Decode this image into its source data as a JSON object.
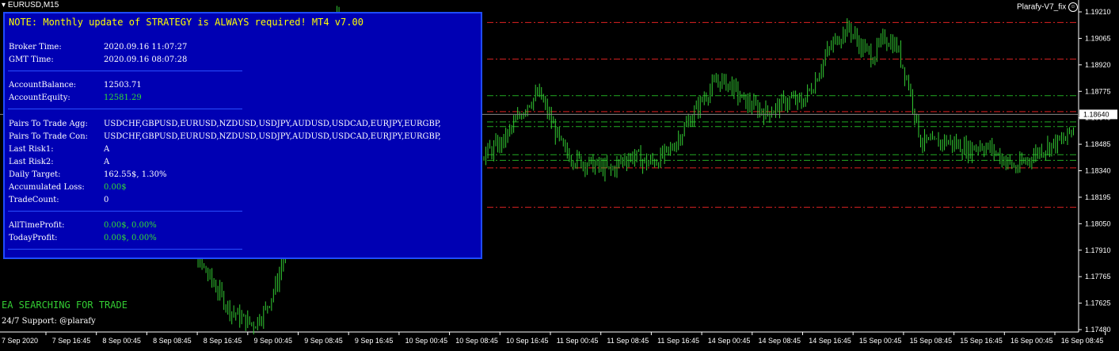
{
  "window": {
    "symbol_title": "EURUSD,M15",
    "ea_name": "Plarafy-V7_fix"
  },
  "panel": {
    "note": "NOTE: Monthly update of STRATEGY is ALWAYS required! MT4 v7.00",
    "rows": [
      {
        "label": "Broker Time:",
        "value": "2020.09.16 11:07:27"
      },
      {
        "label": "GMT Time:",
        "value": "2020.09.16 08:07:28"
      },
      {
        "label": "AccountBalance:",
        "value": "12503.71"
      },
      {
        "label": "AccountEquity:",
        "value": "12581.29"
      },
      {
        "label": "Pairs To Trade Agg:",
        "value": "USDCHF,GBPUSD,EURUSD,NZDUSD,USDJPY,AUDUSD,USDCAD,EURJPY,EURGBP,"
      },
      {
        "label": "Pairs To Trade Con:",
        "value": "USDCHF,GBPUSD,EURUSD,NZDUSD,USDJPY,AUDUSD,USDCAD,EURJPY,EURGBP,"
      },
      {
        "label": "Last Risk1:",
        "value": "A"
      },
      {
        "label": "Last Risk2:",
        "value": "A"
      },
      {
        "label": "Daily Target:",
        "value": "162.55$, 1.30%"
      },
      {
        "label": "Accumulated Loss:",
        "value": "0.00$"
      },
      {
        "label": "TradeCount:",
        "value": "0"
      },
      {
        "label": "AllTimeProfit:",
        "value": "0.00$, 0.00%"
      },
      {
        "label": "TodayProfit:",
        "value": "0.00$, 0.00%"
      }
    ]
  },
  "status_text": "EA SEARCHING FOR TRADE",
  "support_text": "24/7 Support: @plarafy",
  "price_axis": {
    "labels": [
      "1.19210",
      "1.19065",
      "1.18920",
      "1.18775",
      "1.18640",
      "1.18485",
      "1.18340",
      "1.18195",
      "1.18050",
      "1.17910",
      "1.17765",
      "1.17625",
      "1.17480"
    ],
    "current_price": "1.18640"
  },
  "time_axis": {
    "labels": [
      "7 Sep 2020",
      "7 Sep 16:45",
      "8 Sep 00:45",
      "8 Sep 08:45",
      "8 Sep 16:45",
      "9 Sep 00:45",
      "9 Sep 08:45",
      "9 Sep 16:45",
      "10 Sep 00:45",
      "10 Sep 08:45",
      "10 Sep 16:45",
      "11 Sep 00:45",
      "11 Sep 08:45",
      "11 Sep 16:45",
      "14 Sep 00:45",
      "14 Sep 08:45",
      "14 Sep 16:45",
      "15 Sep 00:45",
      "15 Sep 08:45",
      "15 Sep 16:45",
      "16 Sep 00:45",
      "16 Sep 08:45"
    ]
  },
  "colors": {
    "bars": "#33cc33",
    "red_level": "#dd2222",
    "green_level": "#22aa22",
    "panel_bg": "#0000b3",
    "note": "#ffff00"
  },
  "chart_data": {
    "type": "line",
    "title": "EURUSD,M15",
    "y_range": [
      1.1748,
      1.1925
    ],
    "red_levels": [
      1.1913,
      1.18935,
      1.18655,
      1.18355,
      1.18145
    ],
    "green_levels": [
      1.1874,
      1.186,
      1.18575,
      1.18425,
      1.18395
    ],
    "close_series": [
      1.182,
      1.18,
      1.179,
      1.178,
      1.177,
      1.176,
      1.1755,
      1.1752,
      1.176,
      1.1775,
      1.18,
      1.183,
      1.186,
      1.189,
      1.1915,
      1.1905,
      1.188,
      1.185,
      1.183,
      1.181,
      1.1815,
      1.182,
      1.183,
      1.1835,
      1.1838,
      1.184,
      1.1842,
      1.1845,
      1.185,
      1.186,
      1.187,
      1.1875,
      1.186,
      1.1845,
      1.184,
      1.1838,
      1.1836,
      1.1834,
      1.184,
      1.1842,
      1.1838,
      1.184,
      1.1845,
      1.1855,
      1.1865,
      1.1875,
      1.1882,
      1.188,
      1.1872,
      1.1868,
      1.1865,
      1.1868,
      1.1872,
      1.187,
      1.188,
      1.1895,
      1.1905,
      1.191,
      1.19,
      1.1895,
      1.1905,
      1.19,
      1.188,
      1.185,
      1.1848,
      1.185,
      1.1848,
      1.1845,
      1.1848,
      1.1845,
      1.184,
      1.1835,
      1.184,
      1.1845,
      1.1848,
      1.185,
      1.1858
    ]
  }
}
